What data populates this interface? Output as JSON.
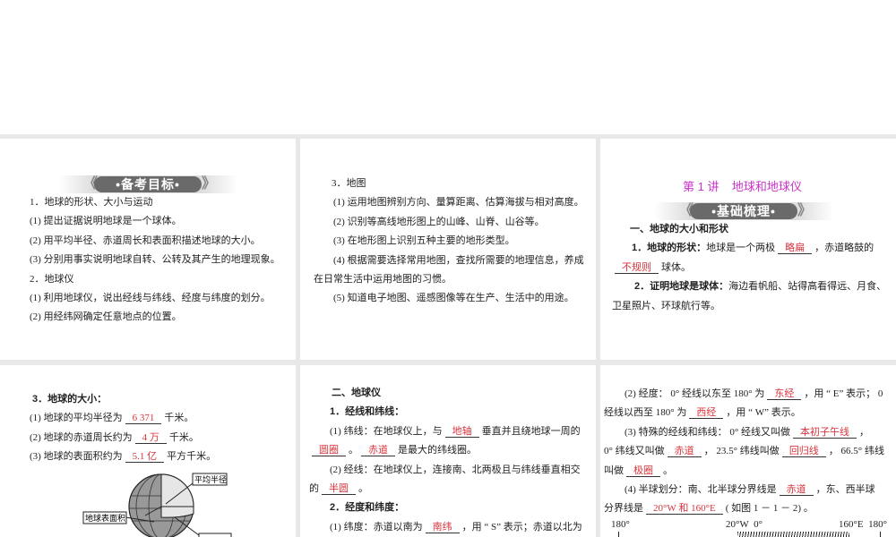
{
  "colors": {
    "answer": "#d8343c",
    "title": "#cc33cc",
    "background": "#e8e8e8"
  },
  "p1": {
    "banner": "•备考目标•",
    "lines": [
      [
        {
          "t": "1．地球的形状、大小与运动"
        }
      ],
      [
        {
          "t": "(1) 提出证据说明地球是一个球体。"
        }
      ],
      [
        {
          "t": "(2) 用平均半径、赤道周长和表面积描述地球的大小。"
        }
      ],
      [
        {
          "t": "(3) 分别用事实说明地球自转、公转及其产生的地理现象。"
        }
      ],
      [
        {
          "t": "2．地球仪"
        }
      ],
      [
        {
          "t": "(1) 利用地球仪，说出经线与纬线、经度与纬度的划分。"
        }
      ],
      [
        {
          "t": "(2) 用经纬网确定任意地点的位置。"
        }
      ]
    ]
  },
  "p2": {
    "lines": [
      [
        {
          "t": "3．地图"
        }
      ],
      [
        {
          "t": "(1) 运用地图辨别方向、量算距离、估算海拔与相对高度。"
        }
      ],
      [
        {
          "t": "(2) 识别等高线地形图上的山峰、山脊、山谷等。"
        }
      ],
      [
        {
          "t": "(3) 在地形图上识别五种主要的地形类型。"
        }
      ],
      [
        {
          "t": "(4) 根据需要选择常用地图，查找所需要的地理信息，养成"
        }
      ],
      [
        {
          "t": "在日常生活中运用地图的习惯。"
        }
      ],
      [
        {
          "t": "(5) 知道电子地图、遥感图像等在生产、生活中的用途。"
        }
      ]
    ]
  },
  "p3": {
    "title": "第 1 讲    地球和地球仪",
    "banner": "•基础梳理•",
    "lines": [
      [
        {
          "h": "一、地球的大小和形状"
        }
      ],
      [
        {
          "h": "1．地球的形状："
        },
        {
          "t": "地球是一个两极"
        },
        {
          "b": "略扁"
        },
        {
          "t": "，赤道略鼓的"
        }
      ],
      [
        {
          "b": "不规则"
        },
        {
          "t": "球体。"
        }
      ],
      [
        {
          "h": "2．证明地球是球体："
        },
        {
          "t": "海边看帆船、站得高看得远、月食、"
        }
      ],
      [
        {
          "t": "卫星照片、环球航行等。"
        }
      ]
    ]
  },
  "p4": {
    "lines": [
      [
        {
          "h": "3．地球的大小："
        }
      ],
      [
        {
          "t": "(1) 地球的平均半径为"
        },
        {
          "b": "6 371"
        },
        {
          "t": "千米。"
        }
      ],
      [
        {
          "t": "(2) 地球的赤道周长约为"
        },
        {
          "b": "4 万"
        },
        {
          "t": "千米。"
        }
      ],
      [
        {
          "t": "(3) 地球的表面积约为"
        },
        {
          "b": "5.1 亿"
        },
        {
          "t": "平方千米。"
        }
      ]
    ],
    "figure": {
      "label_radius": "平均半径",
      "label_area": "地球表面积"
    }
  },
  "p5": {
    "lines": [
      [
        {
          "h": "二、地球仪"
        }
      ],
      [
        {
          "h": "1．经线和纬线："
        }
      ],
      [
        {
          "t": "(1) 纬线：在地球仪上，与"
        },
        {
          "b": "地轴"
        },
        {
          "t": "垂直并且绕地球一周的"
        }
      ],
      [
        {
          "b": "圆圈"
        },
        {
          "t": "。"
        },
        {
          "b": "赤道"
        },
        {
          "t": "是最大的纬线圈。"
        }
      ],
      [
        {
          "t": "(2) 经线：在地球仪上，连接南、北两极且与纬线垂直相交"
        }
      ],
      [
        {
          "t": "的"
        },
        {
          "b": "半圆"
        },
        {
          "t": "。"
        }
      ],
      [
        {
          "h": "2．经度和纬度："
        }
      ],
      [
        {
          "t": "(1) 纬度：赤道以南为"
        },
        {
          "b": "南纬"
        },
        {
          "t": "，用 “ S” 表示；赤道以北为"
        }
      ]
    ]
  },
  "p6": {
    "lines": [
      [
        {
          "t": "(2) 经度： 0° 经线以东至  180° 为"
        },
        {
          "b": "东经"
        },
        {
          "t": "，用 “ E” 表示； 0"
        }
      ],
      [
        {
          "t": "经线以西至  180° 为"
        },
        {
          "b": "西经"
        },
        {
          "t": "，用 “ W” 表示。"
        }
      ],
      [
        {
          "t": "(3) 特殊的经线和纬线： 0° 经线又叫做"
        },
        {
          "b": "本初子午线"
        },
        {
          "t": "，"
        }
      ],
      [
        {
          "t": "0° 纬线又叫做"
        },
        {
          "b": "赤道"
        },
        {
          "t": "， 23.5° 纬线叫做"
        },
        {
          "b": "回归线"
        },
        {
          "t": "， 66.5° 纬线"
        }
      ],
      [
        {
          "t": "叫做"
        },
        {
          "b": "极圈"
        },
        {
          "t": "。"
        }
      ],
      [
        {
          "t": "(4) 半球划分：南、北半球分界线是"
        },
        {
          "b": "赤道"
        },
        {
          "t": "，东、西半球"
        }
      ],
      [
        {
          "t": "分界线是"
        },
        {
          "b": "20°W  和  160°E"
        },
        {
          "t": "( 如图  1 － 1 － 2) 。"
        }
      ]
    ],
    "ruler": {
      "left": "180°",
      "mid": "20°W  0°",
      "right": "160°E  180°"
    }
  }
}
